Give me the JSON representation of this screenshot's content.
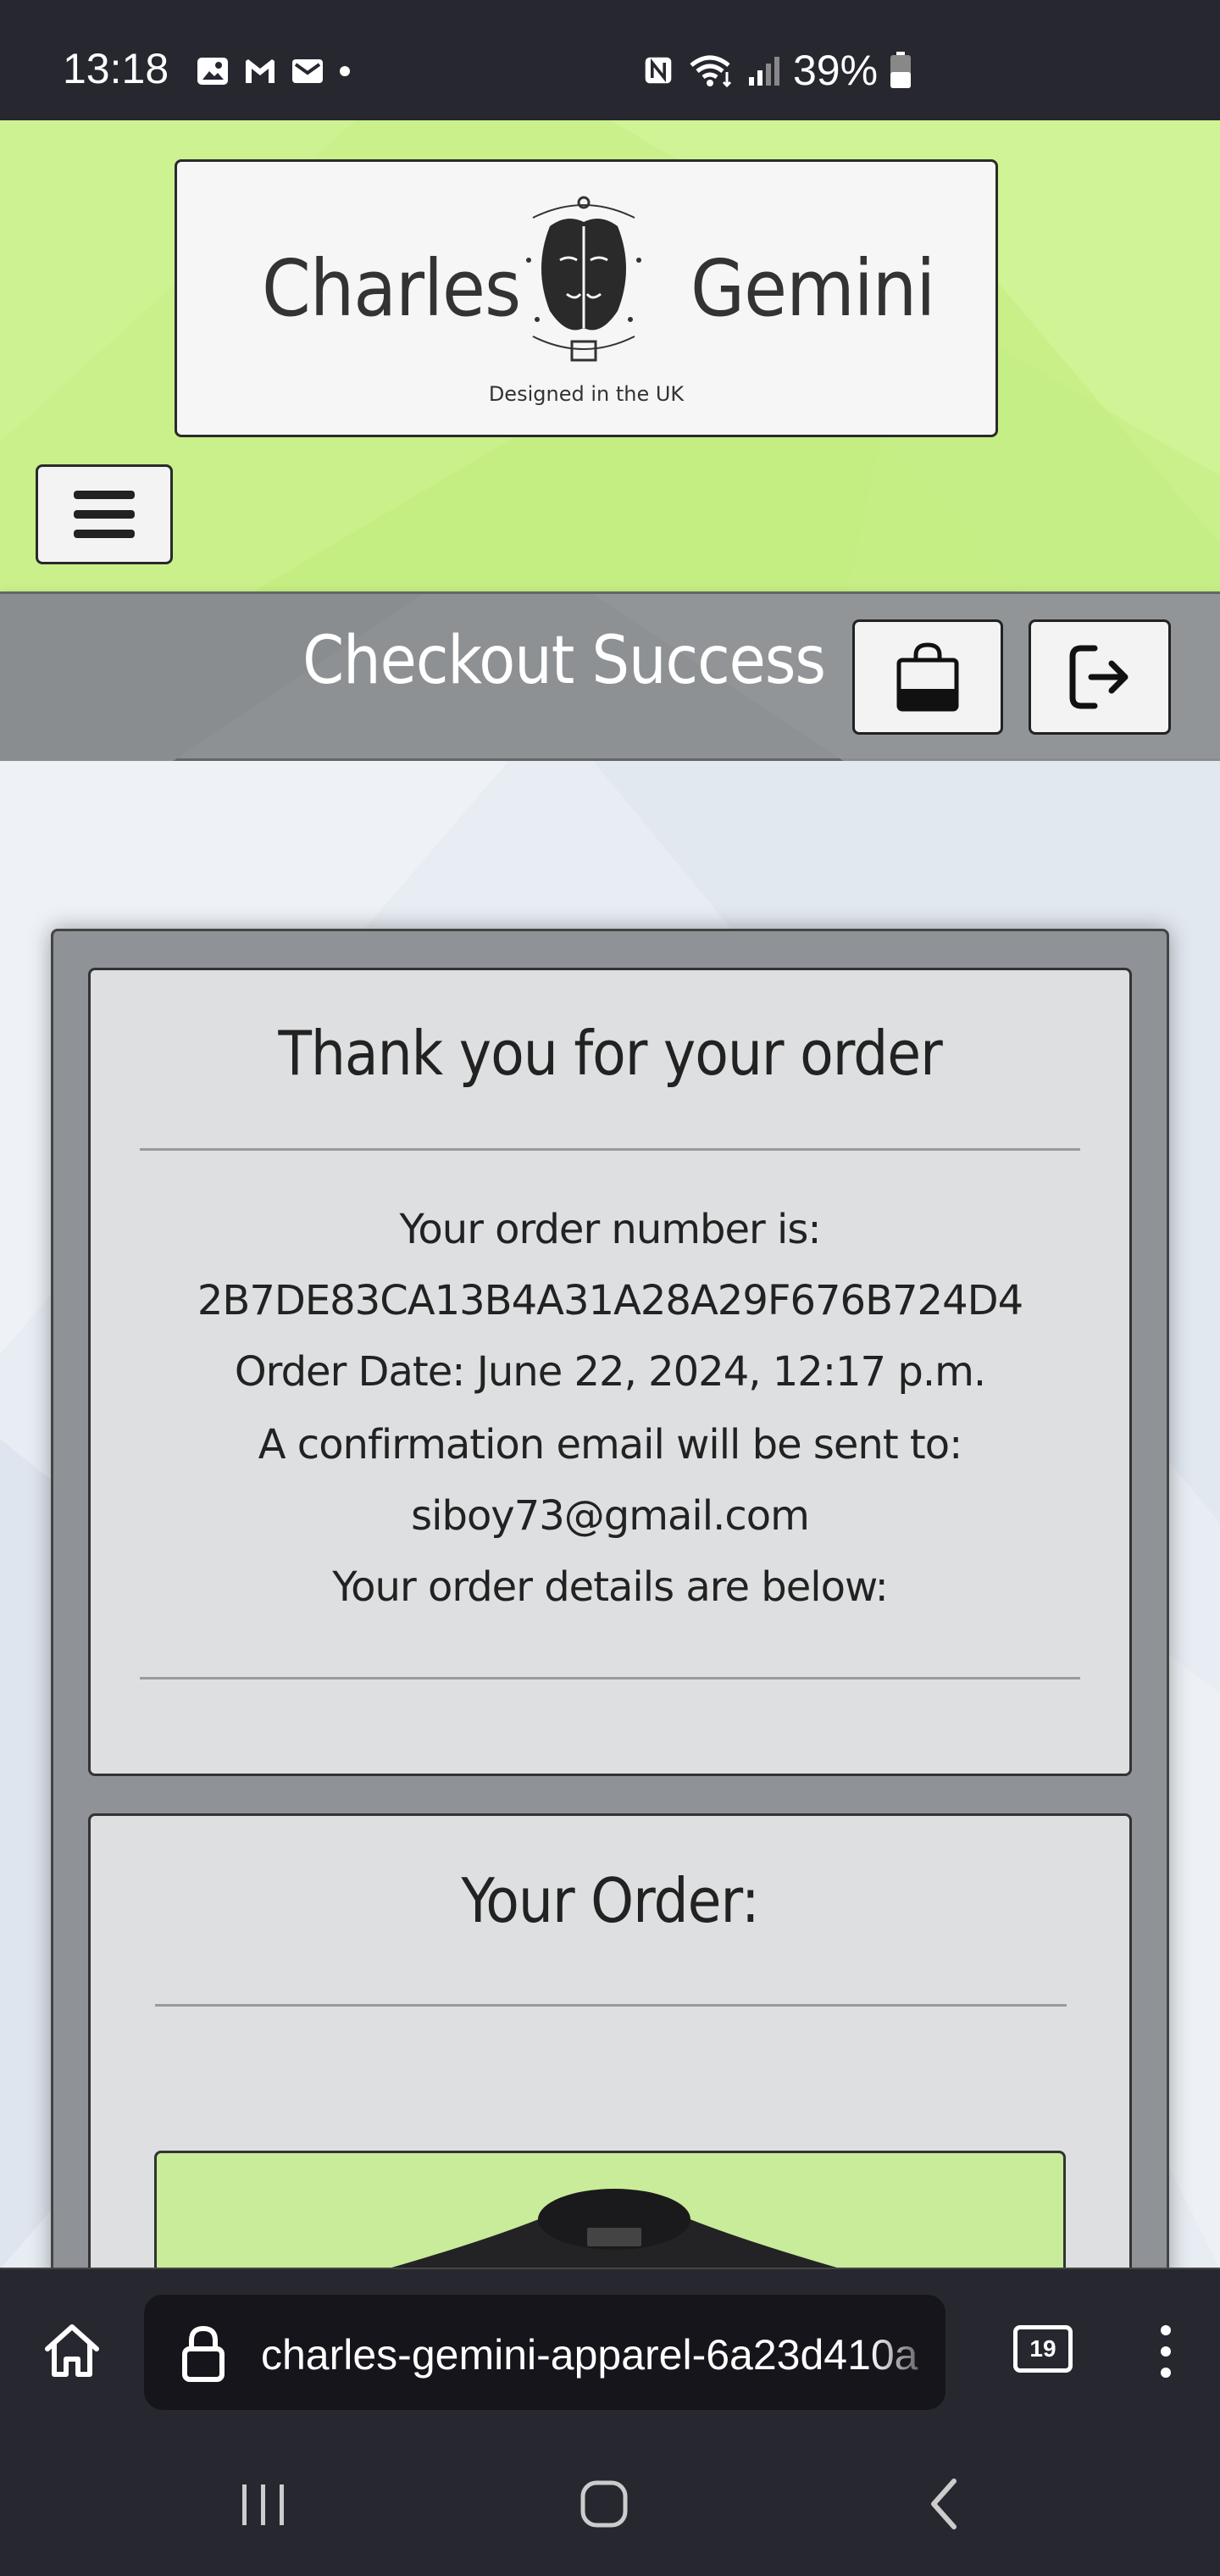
{
  "status_bar": {
    "time": "13:18",
    "battery": "39%",
    "icons_left": [
      "image-icon",
      "gmail-icon",
      "mail-icon",
      "dot-icon"
    ],
    "icons_right": [
      "nfc-icon",
      "wifi-icon",
      "signal-icon",
      "battery-icon"
    ]
  },
  "header": {
    "logo": {
      "word_left": "Charles",
      "word_right": "Gemini",
      "tagline": "Designed in the UK"
    },
    "menu_icon": "hamburger-icon"
  },
  "title_band": {
    "title": "Checkout Success",
    "bag_icon": "shopping-bag-icon",
    "logout_icon": "logout-icon"
  },
  "confirmation": {
    "heading": "Thank you for your order",
    "order_number_label": "Your order number is:",
    "order_number": "2B7DE83CA13B4A31A28A29F676B724D4",
    "order_date": "Order Date: June 22, 2024, 12:17 p.m.",
    "email_label": "A confirmation email will be sent to:",
    "email": "siboy73@gmail.com",
    "details_label": "Your order details are below:"
  },
  "order": {
    "heading": "Your Order:"
  },
  "browser": {
    "url": "charles-gemini-apparel-6a23d410a",
    "tab_count": "19"
  },
  "colors": {
    "header_green": "#c9f08a",
    "title_band_grey": "#8e9193",
    "card_grey": "#dedfe0",
    "system_bar": "#272730"
  }
}
